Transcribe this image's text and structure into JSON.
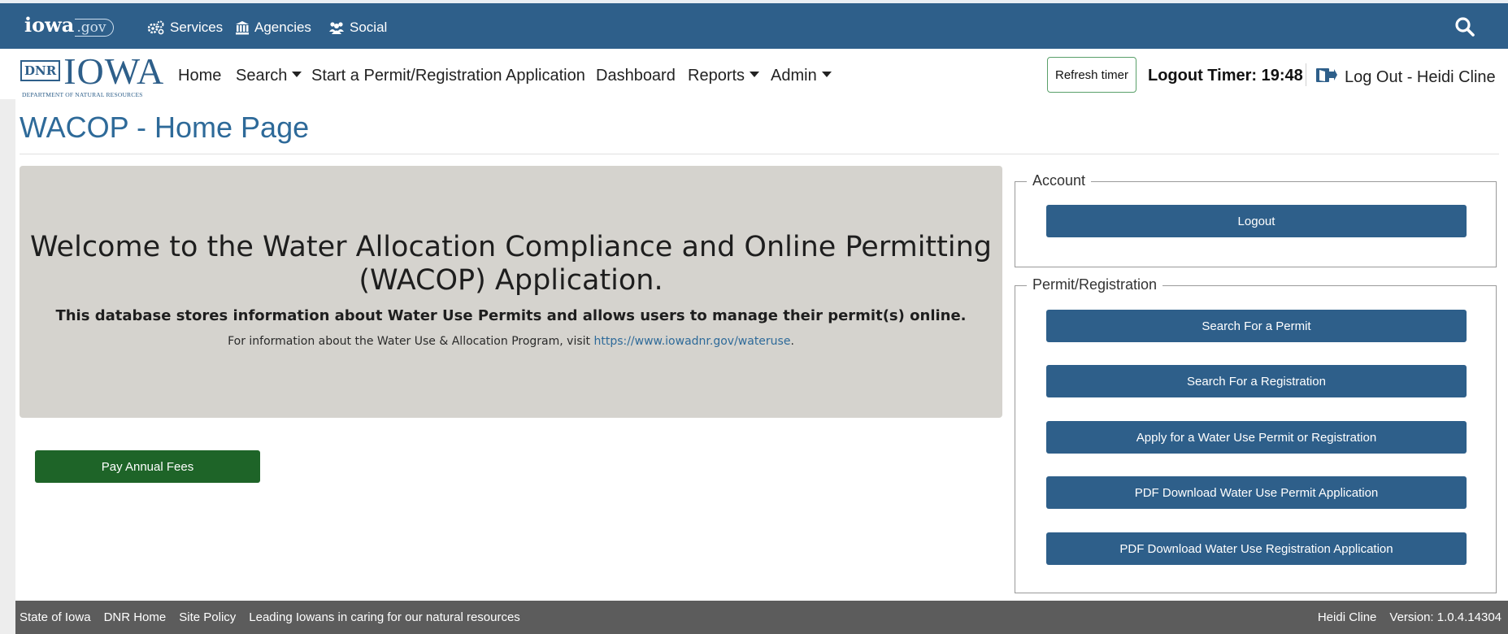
{
  "state_bar": {
    "logo_text": "iowa",
    "logo_suffix": ".gov",
    "links": [
      {
        "label": "Services",
        "icon": "gears-icon"
      },
      {
        "label": "Agencies",
        "icon": "building-icon"
      },
      {
        "label": "Social",
        "icon": "people-icon"
      }
    ],
    "search_icon": "search-icon"
  },
  "navbar": {
    "logo_mark": "DNR",
    "logo_word": "IOWA",
    "logo_sub": "DEPARTMENT OF NATURAL RESOURCES",
    "items": [
      {
        "label": "Home",
        "dropdown": false
      },
      {
        "label": "Search",
        "dropdown": true
      },
      {
        "label": "Start a Permit/Registration Application",
        "dropdown": false
      },
      {
        "label": "Dashboard",
        "dropdown": false
      },
      {
        "label": "Reports",
        "dropdown": true
      },
      {
        "label": "Admin",
        "dropdown": true
      }
    ],
    "refresh_label": "Refresh timer",
    "logout_timer": "Logout Timer: 19:48",
    "logout_link": "Log Out - Heidi Cline"
  },
  "page": {
    "title": "WACOP - Home Page"
  },
  "jumbotron": {
    "heading_line1": "Welcome to the Water Allocation Compliance and Online Permitting",
    "heading_line2": "(WACOP) Application.",
    "lead": "This database stores information about Water Use Permits and allows users to manage their permit(s) online.",
    "info_prefix": "For information about the Water Use & Allocation Program, visit ",
    "info_link": "https://www.iowadnr.gov/wateruse",
    "info_suffix": "."
  },
  "pay_button": "Pay Annual Fees",
  "account": {
    "legend": "Account",
    "logout_button": "Logout"
  },
  "permit_registration": {
    "legend": "Permit/Registration",
    "buttons": [
      "Search For a Permit",
      "Search For a Registration",
      "Apply for a Water Use Permit or Registration",
      "PDF Download Water Use Permit Application",
      "PDF Download Water Use Registration Application"
    ]
  },
  "footer": {
    "links": [
      "State of Iowa",
      "DNR Home",
      "Site Policy"
    ],
    "tagline": "Leading Iowans in caring for our natural resources",
    "user": "Heidi Cline",
    "version": "Version: 1.0.4.14304"
  },
  "colors": {
    "brand_blue": "#2e5f8a",
    "pay_green": "#1e6428",
    "jumbotron_bg": "#d5d3ce",
    "footer_bg": "#5c5c5c"
  }
}
